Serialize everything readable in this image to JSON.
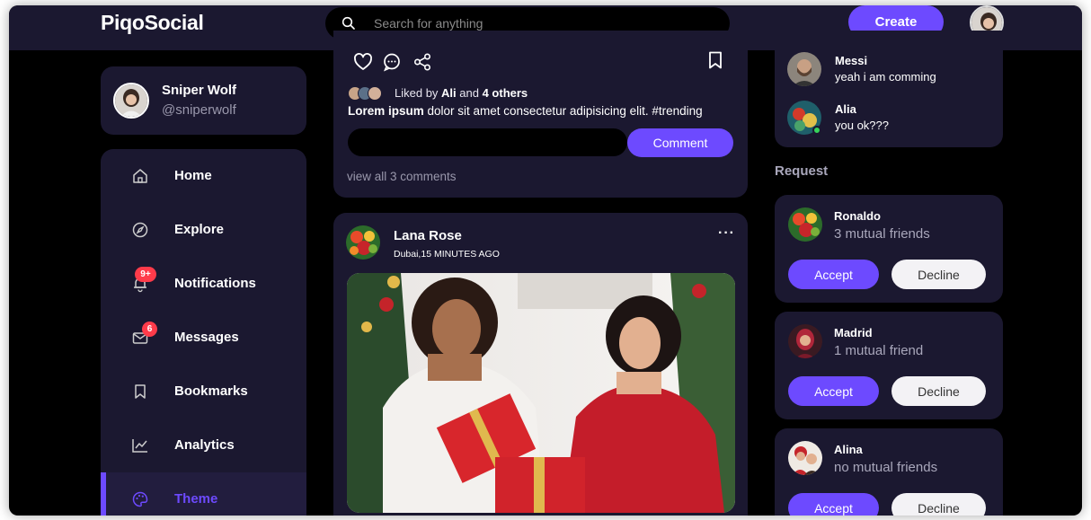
{
  "app": {
    "logo": "PiqoSocial"
  },
  "nav": {
    "search_placeholder": "Search for anything",
    "create_label": "Create"
  },
  "profile": {
    "name": "Sniper Wolf",
    "handle": "@sniperwolf"
  },
  "sidebar": {
    "items": [
      {
        "label": "Home",
        "icon": "home-icon"
      },
      {
        "label": "Explore",
        "icon": "compass-icon"
      },
      {
        "label": "Notifications",
        "icon": "bell-icon",
        "badge": "9+"
      },
      {
        "label": "Messages",
        "icon": "mail-icon",
        "badge": "6"
      },
      {
        "label": "Bookmarks",
        "icon": "bookmark-icon"
      },
      {
        "label": "Analytics",
        "icon": "chart-icon"
      },
      {
        "label": "Theme",
        "icon": "palette-icon",
        "active": true
      }
    ]
  },
  "feed": {
    "post1": {
      "liked_prefix": "Liked by ",
      "liked_user": "Ali",
      "liked_mid": " and ",
      "liked_others": "4 others",
      "caption_user": "Lorem ipsum",
      "caption_text": " dolor sit amet consectetur adipisicing elit. #trending",
      "comment_button": "Comment",
      "view_all": "view all 3 comments"
    },
    "post2": {
      "author": "Lana Rose",
      "meta": "Dubai,15 MINUTES AGO",
      "more": "···"
    }
  },
  "messages": [
    {
      "name": "Messi",
      "text": "yeah i am comming"
    },
    {
      "name": "Alia",
      "text": "you ok???",
      "online": true
    }
  ],
  "requests": {
    "title": "Request",
    "accept_label": "Accept",
    "decline_label": "Decline",
    "items": [
      {
        "name": "Ronaldo",
        "mutual": "3 mutual friends"
      },
      {
        "name": "Madrid",
        "mutual": "1 mutual friend"
      },
      {
        "name": "Alina",
        "mutual": "no mutual friends"
      }
    ]
  },
  "colors": {
    "accent": "#6d4aff",
    "card": "#1b1830",
    "background": "#000000",
    "badge": "#ff3b4a"
  }
}
